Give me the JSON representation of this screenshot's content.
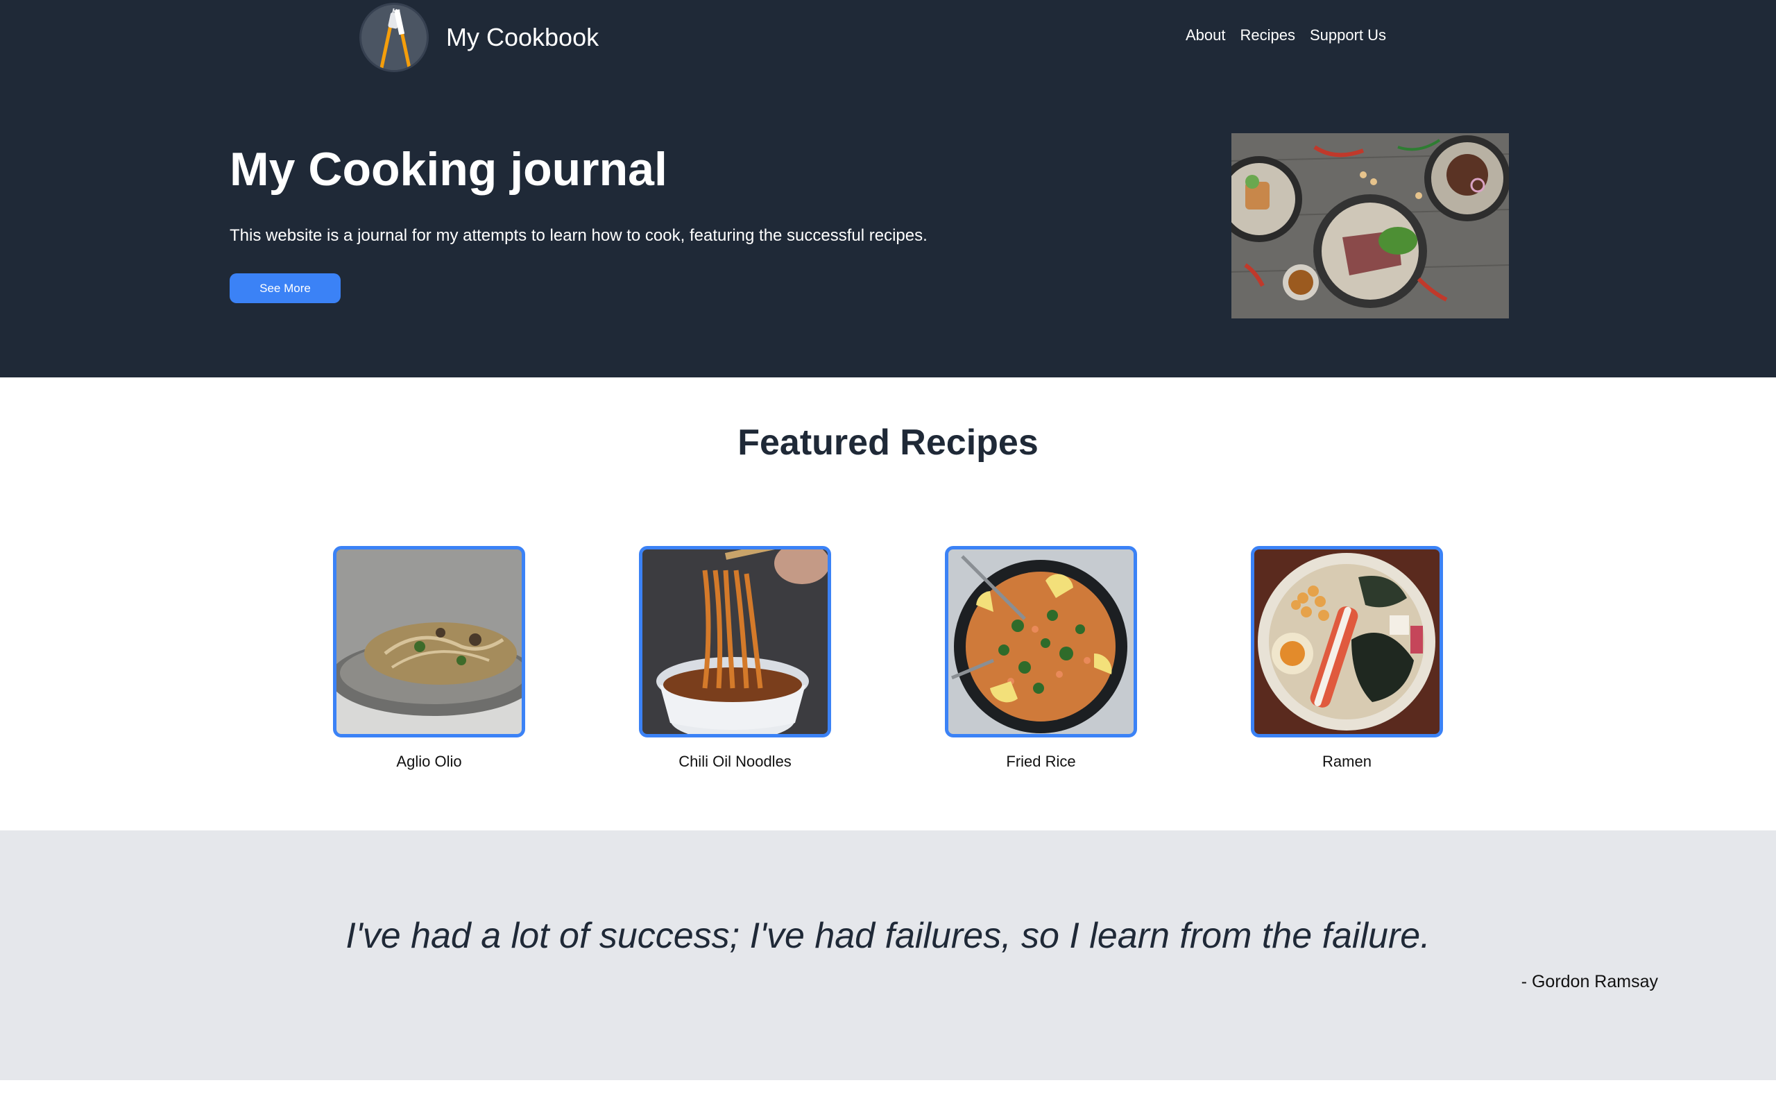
{
  "header": {
    "brand": "My Cookbook",
    "logo_icon": "fork-knife-icon",
    "nav": [
      "About",
      "Recipes",
      "Support Us"
    ]
  },
  "hero": {
    "title": "My Cooking journal",
    "subtitle": "This website is a journal for my attempts to learn how to cook, featuring the successful recipes.",
    "button": "See More"
  },
  "featured": {
    "title": "Featured Recipes",
    "recipes": [
      {
        "name": "Aglio Olio"
      },
      {
        "name": "Chili Oil Noodles"
      },
      {
        "name": "Fried Rice"
      },
      {
        "name": "Ramen"
      }
    ]
  },
  "quote": {
    "text": "I've had a lot of success; I've had failures, so I learn from the failure.",
    "author": "- Gordon Ramsay"
  },
  "colors": {
    "header_bg": "#1f2937",
    "accent": "#3b82f6",
    "quote_bg": "#e5e7eb"
  }
}
